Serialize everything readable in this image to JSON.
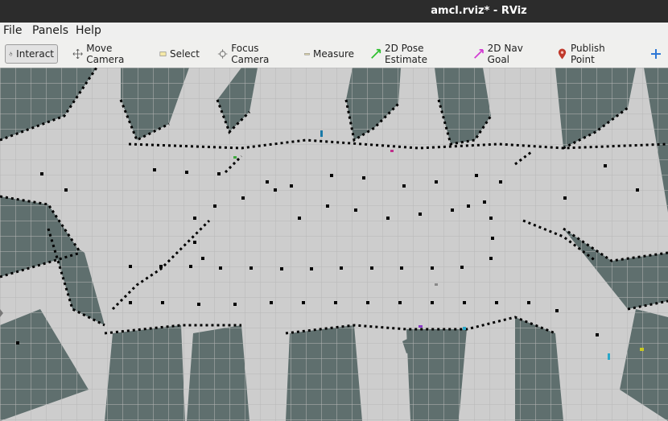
{
  "window": {
    "title": "amcl.rviz* - RViz"
  },
  "menu": [
    {
      "label": "File"
    },
    {
      "label": "Panels"
    },
    {
      "label": "Help"
    }
  ],
  "toolbar": {
    "tools": [
      {
        "label": "Interact",
        "icon": "hand-pointer-icon"
      },
      {
        "label": "Move Camera",
        "icon": "move-camera-icon"
      },
      {
        "label": "Select",
        "icon": "select-box-icon"
      },
      {
        "label": "Focus Camera",
        "icon": "focus-target-icon"
      },
      {
        "label": "Measure",
        "icon": "ruler-icon"
      },
      {
        "label": "2D Pose Estimate",
        "icon": "green-arrow-icon"
      },
      {
        "label": "2D Nav Goal",
        "icon": "magenta-arrow-icon"
      },
      {
        "label": "Publish Point",
        "icon": "map-pin-icon"
      }
    ],
    "add_tool_icon": "plus-icon"
  },
  "colors": {
    "free_space": "#cdcdcd",
    "unknown_space": "#5f6f6e",
    "obstacle": "#000000",
    "grid_line": "#b6b6b6"
  }
}
